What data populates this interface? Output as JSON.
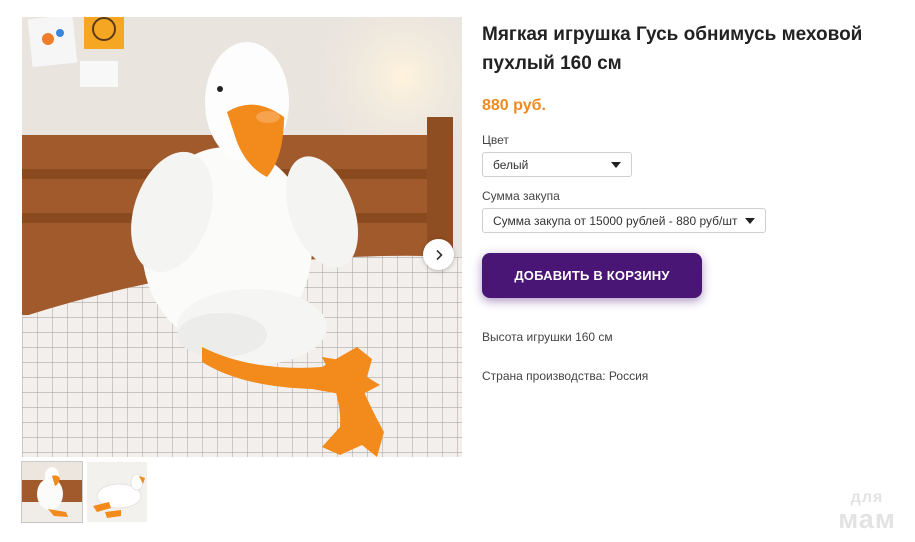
{
  "product": {
    "title": "Мягкая игрушка Гусь обнимусь меховой пухлый 160 см",
    "price": "880 руб."
  },
  "options": {
    "color_label": "Цвет",
    "color_value": "белый",
    "purchase_label": "Сумма закупа",
    "purchase_value": "Сумма закупа от 15000 рублей - 880 руб/шт"
  },
  "cart": {
    "add_label": "ДОБАВИТЬ В КОРЗИНУ"
  },
  "description": {
    "height": "Высота игрушки 160 см",
    "country": "Страна производства: Россия"
  },
  "gallery": {
    "main_image": "plush-white-goose-on-bed",
    "thumbnails": [
      "goose-sitting-thumbnail",
      "goose-lying-thumbnail"
    ],
    "active_thumbnail": 0
  },
  "watermark": {
    "line1": "для",
    "line2": "мам"
  },
  "colors": {
    "accent_price": "#ef8a21",
    "button": "#4a1675",
    "goose_beak": "#f28a1c"
  }
}
